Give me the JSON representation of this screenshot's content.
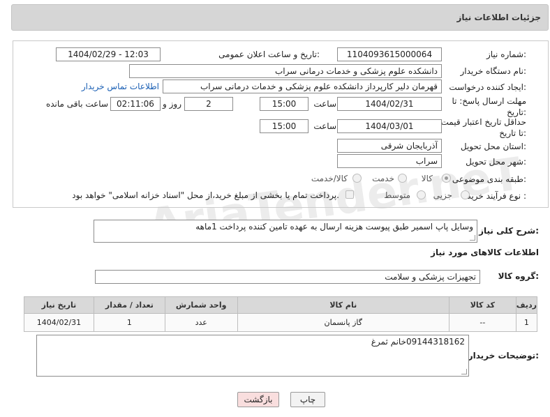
{
  "header": {
    "title": "جزئیات اطلاعات نیاز"
  },
  "form": {
    "need_number_label": "شماره نیاز:",
    "need_number": "1104093615000064",
    "announce_label": "تاریخ و ساعت اعلان عمومی:",
    "announce_value": "1404/02/29 - 12:03",
    "buyer_org_label": "نام دستگاه خریدار:",
    "buyer_org": "دانشکده علوم پزشکی و خدمات درمانی سراب",
    "creator_label": "ایجاد کننده درخواست:",
    "creator": "قهرمان دلیر کارپرداز دانشکده علوم پزشکی و خدمات درمانی سراب",
    "contact_link": "اطلاعات تماس خریدار",
    "reply_deadline_label": "مهلت ارسال پاسخ: تا تاریخ:",
    "reply_date": "1404/02/31",
    "time_label": "ساعت",
    "reply_time": "15:00",
    "days_value": "2",
    "days_label": "روز و",
    "remaining_value": "02:11:06",
    "remaining_label": "ساعت باقی مانده",
    "price_deadline_label": "حداقل تاریخ اعتبار قیمت: تا تاریخ:",
    "price_date": "1404/03/01",
    "price_time": "15:00",
    "province_label": "استان محل تحویل:",
    "province": "آذربایجان شرقی",
    "city_label": "شهر محل تحویل:",
    "city": "سراب",
    "category_label": "طبقه بندی موضوعی:",
    "category_options": [
      "کالا",
      "خدمت",
      "کالا/خدمت"
    ],
    "category_selected": "کالا",
    "process_label": "نوع فرآیند خرید :",
    "process_options": [
      "جزیی",
      "متوسط"
    ],
    "payment_note": "پرداخت تمام یا بخشی از مبلغ خرید،از محل \"اسناد خزانه اسلامی\" خواهد بود."
  },
  "description": {
    "label": "شرح کلی نیاز:",
    "text": "وسایل پاپ اسمیر طبق پیوست هزینه ارسال به عهده تامین کننده پرداخت 1ماهه"
  },
  "goods": {
    "section_title": "اطلاعات کالاهای مورد نیاز",
    "group_label": "گروه کالا:",
    "group_value": "تجهیزات پزشکی و سلامت",
    "columns": [
      "ردیف",
      "کد کالا",
      "نام کالا",
      "واحد شمارش",
      "تعداد / مقدار",
      "تاریخ نیاز"
    ],
    "rows": [
      [
        "1",
        "--",
        "گاز پانسمان",
        "عدد",
        "1",
        "1404/02/31"
      ]
    ]
  },
  "buyer_notes": {
    "label": "توضیحات خریدار:",
    "text": "09144318162خانم ثمرغ"
  },
  "buttons": {
    "print": "چاپ",
    "back": "بازگشت"
  },
  "watermark": "AriaTender.neT",
  "colors": {
    "back_button_bg": "#f9dede",
    "link": "#1a5fb4"
  }
}
